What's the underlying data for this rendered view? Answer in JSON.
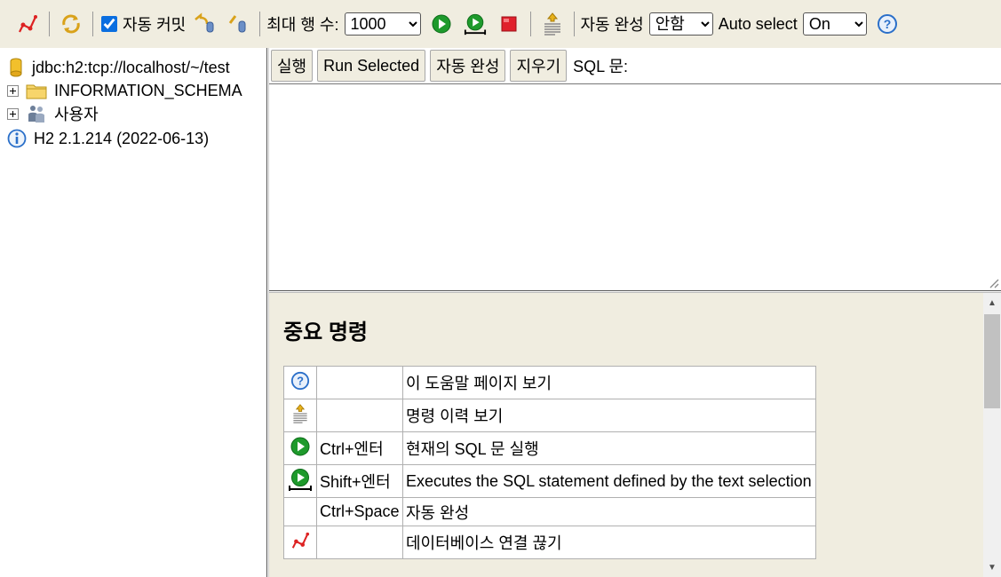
{
  "toolbar": {
    "disconnect_icon": "disconnect-icon",
    "refresh_icon": "refresh-icon",
    "autocommit_label": "자동 커밋",
    "autocommit_checked": true,
    "rollback_icon": "rollback-icon",
    "commit_icon": "commit-icon",
    "max_rows_label": "최대 행 수:",
    "max_rows_value": "1000",
    "run_icon": "run-icon",
    "run_selected_icon": "run-selected-icon",
    "stop_icon": "stop-icon",
    "history_icon": "history-icon",
    "autocomplete_label": "자동 완성",
    "autocomplete_value": "안함",
    "auto_select_label": "Auto select",
    "auto_select_value": "On",
    "help_icon": "help-icon"
  },
  "tree": {
    "connection": "jdbc:h2:tcp://localhost/~/test",
    "items": [
      {
        "label": "INFORMATION_SCHEMA",
        "icon": "folder-icon"
      },
      {
        "label": "사용자",
        "icon": "users-icon"
      }
    ],
    "version": "H2 2.1.214 (2022-06-13)"
  },
  "query": {
    "run_label": "실행",
    "run_selected_label": "Run Selected",
    "autocomplete_label": "자동 완성",
    "clear_label": "지우기",
    "sql_label": "SQL 문:",
    "sql_text": ""
  },
  "help": {
    "title": "중요 명령",
    "rows": [
      {
        "icon": "help-icon",
        "key": "",
        "desc": "이 도움말 페이지 보기"
      },
      {
        "icon": "history-icon",
        "key": "",
        "desc": "명령 이력 보기"
      },
      {
        "icon": "run-icon",
        "key": "Ctrl+엔터",
        "desc": "현재의 SQL 문 실행"
      },
      {
        "icon": "run-selected-icon",
        "key": "Shift+엔터",
        "desc": "Executes the SQL statement defined by the text selection"
      },
      {
        "icon": "",
        "key": "Ctrl+Space",
        "desc": "자동 완성"
      },
      {
        "icon": "disconnect-icon",
        "key": "",
        "desc": "데이터베이스 연결 끊기"
      }
    ]
  },
  "colors": {
    "toolbar_bg": "#f0ede0",
    "run_green": "#1e9a2c",
    "stop_red": "#e0202c",
    "help_blue": "#2a6fc9"
  }
}
